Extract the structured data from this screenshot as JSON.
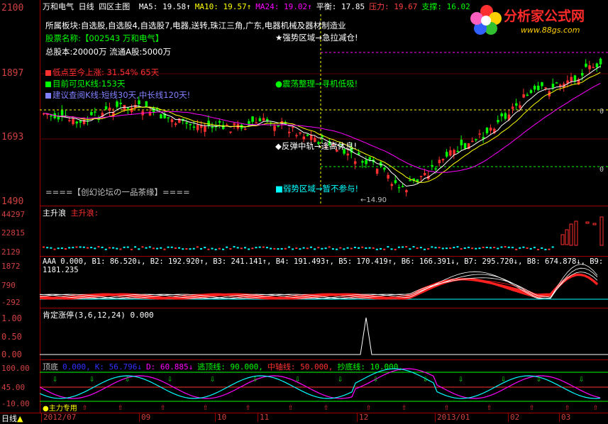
{
  "window": {
    "stock_name": "万和电气",
    "period": "日线",
    "template": "四区主图"
  },
  "main_header": [
    {
      "label": "MA5: 19.58",
      "arrow": "↑",
      "color": "#ffffff"
    },
    {
      "label": "MA10: 19.57",
      "arrow": "↑",
      "color": "#ffff00"
    },
    {
      "label": "MA24: 19.02",
      "arrow": "↑",
      "color": "#ff00ff"
    },
    {
      "label": "平衡: 17.85",
      "arrow": "",
      "color": "#ffffff"
    },
    {
      "label": "压力: 19.67",
      "arrow": "",
      "color": "#ff4040"
    },
    {
      "label": "支撑: 16.02",
      "arrow": "",
      "color": "#00ff00"
    }
  ],
  "info": {
    "sector": "所属板块:自选股,自选股4,自选股7,电器,送转,珠江三角,广东,电器机械及器材制造业",
    "stock_code_label": "股票名称:【002543 万和电气】",
    "capital": "总股本:20000万   流通A股:5000万",
    "low_rise_label": "低点至今上涨: 31.54%   65天",
    "visible_k_label": "目前可见K线:153天",
    "suggest_label": "建议查阅K线:短线30天,中长线120天!",
    "forum": "====【创幻论坛の一品茶缘】===="
  },
  "annotations": {
    "strong": "★强势区域→急拉减仓!",
    "shock": "●震荡整理→寻机低吸!",
    "rebound": "◆反弹中轨→逢高休息!",
    "weak": "■弱势区域→暂不参与!",
    "low_price": "←14.90"
  },
  "logo": {
    "title": "分析家公式网",
    "url": "www.88gs.com"
  },
  "y_axis_main": [
    "2100",
    "1897",
    "1693",
    "1490"
  ],
  "right_edge_labels": [
    "0",
    "0"
  ],
  "panel2": {
    "title": "主升浪",
    "subtitle": "主升浪:",
    "y_ticks": [
      "44297",
      "22815",
      "2129"
    ]
  },
  "panel3": {
    "header": "AAA 0.000, B1: 86.520↓, B2: 192.920↑, B3: 241.141↑, B4: 191.493↑, B5: 170.419↑, B6: 166.391↓, B7: 295.720↓, B8: 674.878↓, B9: 1181.235",
    "y_ticks": [
      "1872",
      "790",
      "-292"
    ]
  },
  "panel4": {
    "header": "肯定涨停(3,6,12,24) 0.000",
    "y_ticks": [
      "1.00",
      "0.50",
      "0.00"
    ]
  },
  "panel5": {
    "header_items": [
      {
        "label": "顶底",
        "color": "#c0c0c0"
      },
      {
        "label": "0.000,",
        "color": "#3030ff"
      },
      {
        "label": "K: 56.796↓",
        "color": "#3030ff"
      },
      {
        "label": "D: 60.885↓",
        "color": "#ff00ff"
      },
      {
        "label": "逃顶线: 90.000,",
        "color": "#00ff00"
      },
      {
        "label": "中轴线: 50.000,",
        "color": "#ff3030"
      },
      {
        "label": "抄底线: 10.000,",
        "color": "#00ff00"
      }
    ],
    "y_ticks": [
      "100.00",
      "45.00",
      "-10.00"
    ],
    "badge": "主力专用"
  },
  "dates": [
    "2012/07",
    "09",
    "10",
    "11",
    "12",
    "2013/01",
    "02",
    "03"
  ],
  "status": {
    "period_tab": "日线"
  },
  "colors": {
    "up": "#ff3030",
    "down": "#00ff00",
    "ma5": "#ffffff",
    "ma10": "#ffff00",
    "ma24": "#ff00ff",
    "axis": "#a00000"
  }
}
